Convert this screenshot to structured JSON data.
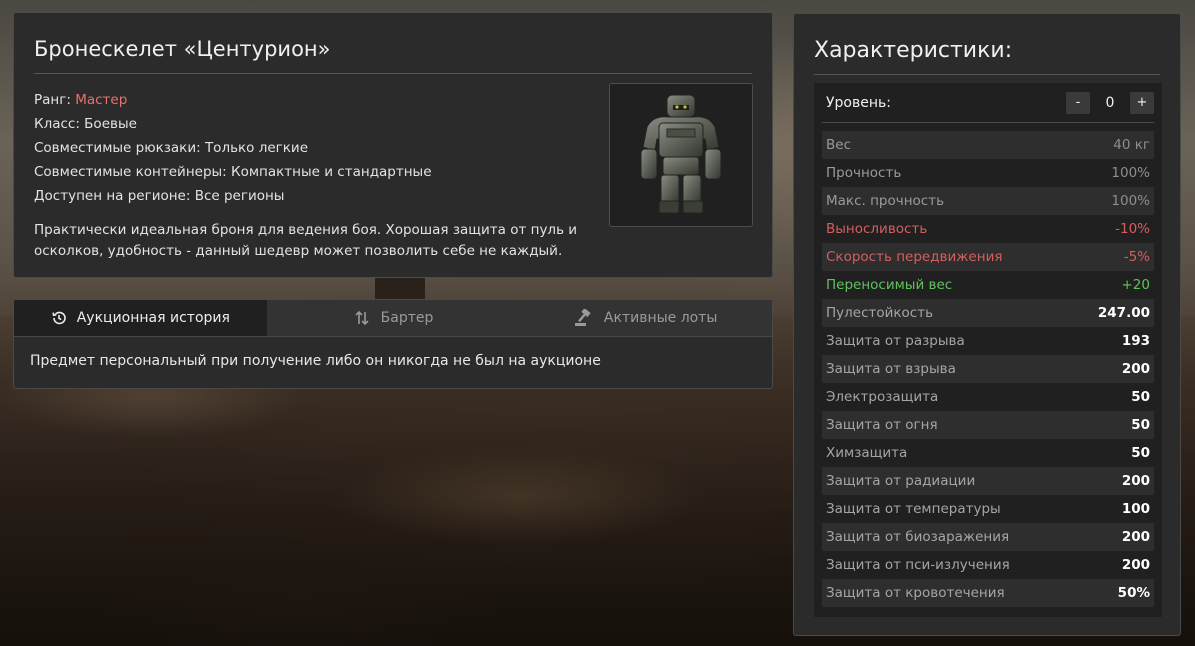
{
  "item": {
    "title": "Бронескелет «Центурион»",
    "rank_label": "Ранг:",
    "rank_value": "Мастер",
    "class_line": "Класс: Боевые",
    "backpacks_line": "Совместимые рюкзаки: Только легкие",
    "containers_line": "Совместимые контейнеры: Компактные и стандартные",
    "region_line": "Доступен на регионе: Все регионы",
    "description": "Практически идеальная броня для ведения боя. Хорошая защита от пуль и осколков, удобность - данный шедевр может позволить себе не каждый."
  },
  "tabs": [
    {
      "label": "Аукционная история",
      "icon": "history-icon",
      "active": true
    },
    {
      "label": "Бартер",
      "icon": "swap-arrows-icon",
      "active": false
    },
    {
      "label": "Активные лоты",
      "icon": "gavel-icon",
      "active": false
    }
  ],
  "auction": {
    "message": "Предмет персональный при получение либо он никогда не был на аукционе"
  },
  "stats": {
    "title": "Характеристики:",
    "level_label": "Уровень:",
    "level_value": "0",
    "minus_label": "-",
    "plus_label": "+",
    "rows": [
      {
        "name": "Вес",
        "value": "40 кг",
        "style": "normal"
      },
      {
        "name": "Прочность",
        "value": "100%",
        "style": "normal"
      },
      {
        "name": "Макс. прочность",
        "value": "100%",
        "style": "normal"
      },
      {
        "name": "Выносливость",
        "value": "-10%",
        "style": "neg"
      },
      {
        "name": "Скорость передвижения",
        "value": "-5%",
        "style": "neg"
      },
      {
        "name": "Переносимый вес",
        "value": "+20",
        "style": "pos"
      },
      {
        "name": "Пулестойкость",
        "value": "247.00",
        "style": "bold"
      },
      {
        "name": "Защита от разрыва",
        "value": "193",
        "style": "bold"
      },
      {
        "name": "Защита от взрыва",
        "value": "200",
        "style": "bold"
      },
      {
        "name": "Электрозащита",
        "value": "50",
        "style": "bold"
      },
      {
        "name": "Защита от огня",
        "value": "50",
        "style": "bold"
      },
      {
        "name": "Химзащита",
        "value": "50",
        "style": "bold"
      },
      {
        "name": "Защита от радиации",
        "value": "200",
        "style": "bold"
      },
      {
        "name": "Защита от температуры",
        "value": "100",
        "style": "bold"
      },
      {
        "name": "Защита от биозаражения",
        "value": "200",
        "style": "bold"
      },
      {
        "name": "Защита от пси-излучения",
        "value": "200",
        "style": "bold"
      },
      {
        "name": "Защита от кровотечения",
        "value": "50%",
        "style": "bold"
      }
    ]
  }
}
